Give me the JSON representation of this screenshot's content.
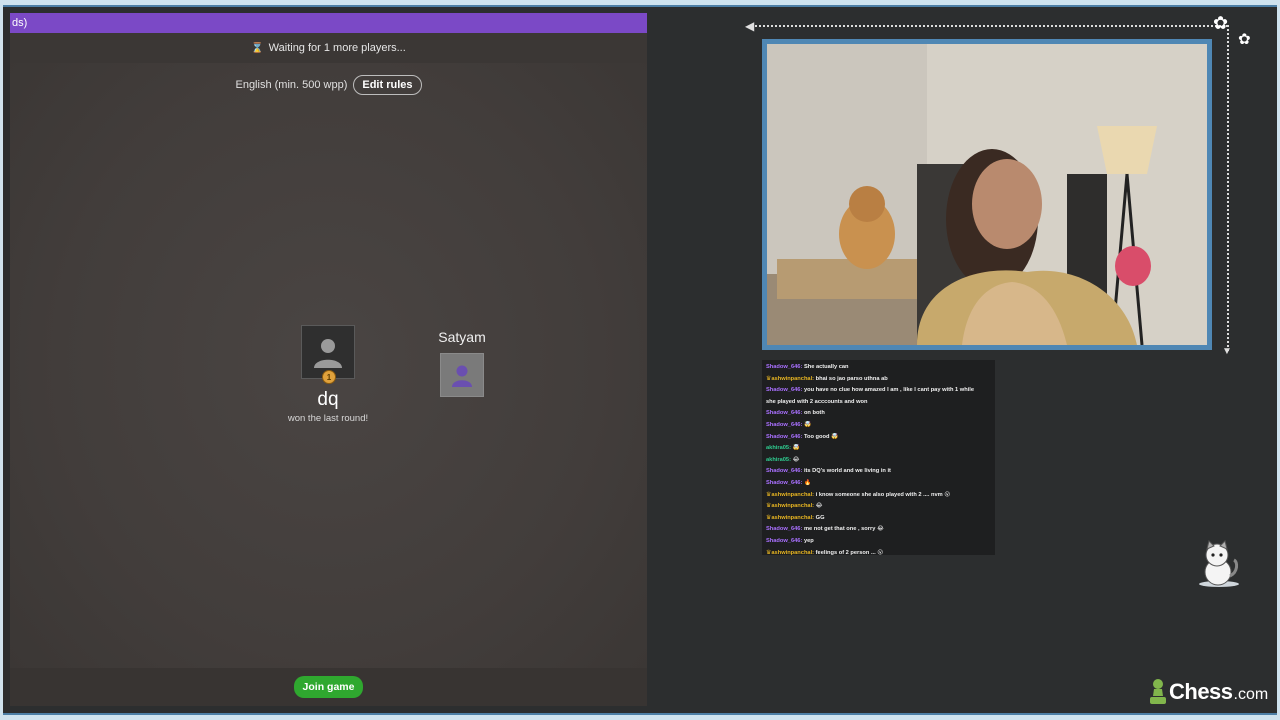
{
  "game": {
    "top_bar_text": "ds)",
    "waiting_text": "Waiting for 1 more players...",
    "rules_text": "English (min. 500 wpp)",
    "edit_rules_label": "Edit rules",
    "players": [
      {
        "name": "dq",
        "status": "won the last round!",
        "medal": "1"
      },
      {
        "name": "Satyam"
      }
    ],
    "join_label": "Join game",
    "accent_color": "#7b49c6",
    "join_color": "#2fa82f"
  },
  "chat": {
    "messages": [
      {
        "user": "Shadow_646:",
        "text": "She actually can",
        "color": "#a970ff",
        "crown": false
      },
      {
        "user": "ashwinpanchal:",
        "text": "bhai so jao parso uthna ab",
        "color": "#e6b422",
        "crown": true
      },
      {
        "user": "Shadow_646:",
        "text": "you have no clue how amazed I am , like I cant pay with 1 while",
        "color": "#a970ff",
        "crown": false
      },
      {
        "user": "",
        "text": "she played with 2 acccounts and won",
        "color": "#a970ff",
        "crown": false
      },
      {
        "user": "Shadow_646:",
        "text": "on both",
        "color": "#a970ff",
        "crown": false
      },
      {
        "user": "Shadow_646:",
        "text": "🤯",
        "color": "#a970ff",
        "crown": false
      },
      {
        "user": "Shadow_646:",
        "text": "Too good 🤯",
        "color": "#a970ff",
        "crown": false
      },
      {
        "user": "akhira05:",
        "text": "🤯",
        "color": "#2ecc8f",
        "crown": false
      },
      {
        "user": "akhira05:",
        "text": "😂",
        "color": "#2ecc8f",
        "crown": false
      },
      {
        "user": "Shadow_646:",
        "text": "its DQ's world and we living in it",
        "color": "#a970ff",
        "crown": false
      },
      {
        "user": "Shadow_646:",
        "text": "🔥",
        "color": "#a970ff",
        "crown": false
      },
      {
        "user": "ashwinpanchal:",
        "text": "i know someone she also played with 2 .... nvm 😮",
        "color": "#e6b422",
        "crown": true
      },
      {
        "user": "ashwinpanchal:",
        "text": "😂",
        "color": "#e6b422",
        "crown": true
      },
      {
        "user": "ashwinpanchal:",
        "text": "GG",
        "color": "#e6b422",
        "crown": true
      },
      {
        "user": "Shadow_646:",
        "text": "me not get that one , sorry 😂",
        "color": "#a970ff",
        "crown": false
      },
      {
        "user": "Shadow_646:",
        "text": "yep",
        "color": "#a970ff",
        "crown": false
      },
      {
        "user": "ashwinpanchal:",
        "text": "feelings of 2 person ... 😮",
        "color": "#e6b422",
        "crown": true
      }
    ]
  },
  "brand": {
    "logo_main": "Chess",
    "logo_suffix": ".com",
    "logo_color": "#81b64c"
  }
}
